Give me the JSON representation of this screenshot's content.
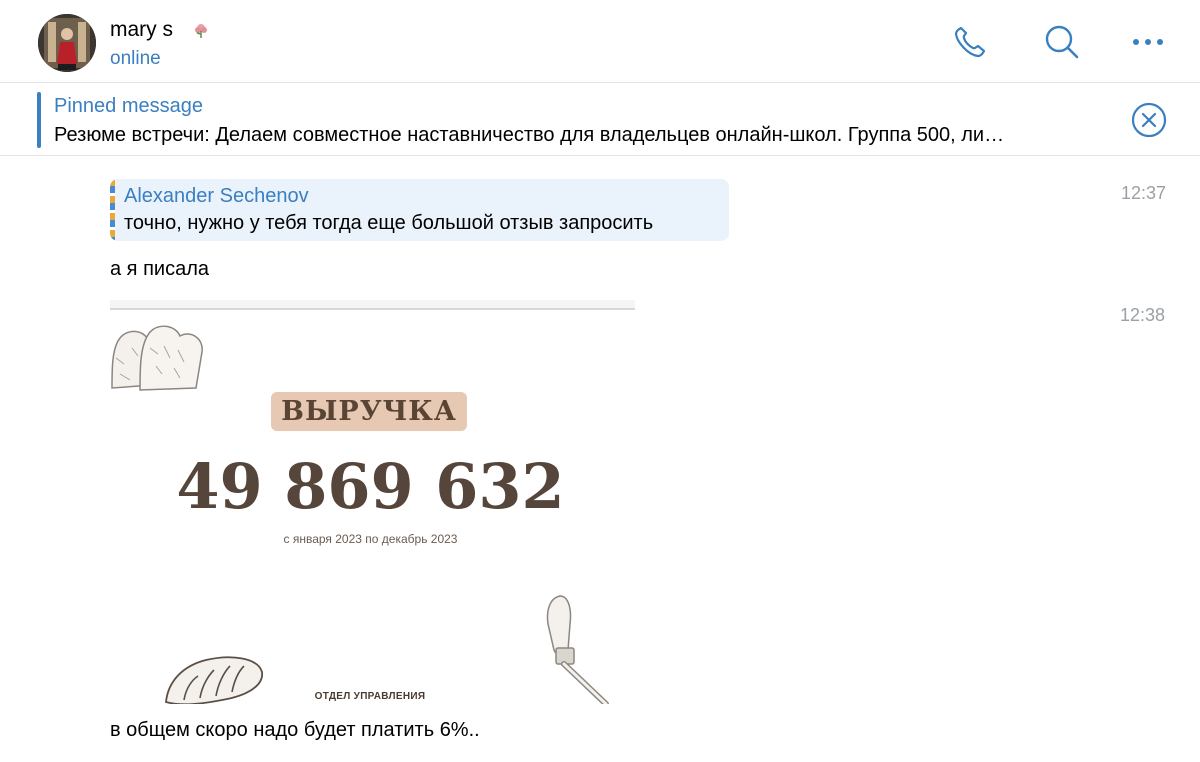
{
  "header": {
    "contact_name": "mary s",
    "status": "online",
    "icons": {
      "avatar": "profile-photo",
      "name_badge": "flower-emoji",
      "call": "phone-icon",
      "search": "search-icon",
      "more": "more-dots-icon"
    },
    "accent_color": "#3a7fc1"
  },
  "pinned": {
    "title": "Pinned message",
    "text": "Резюме встречи: Делаем совместное наставничество для владельцев онлайн-школ. Группа 500, ли…",
    "close_icon": "close-circle-icon"
  },
  "messages": [
    {
      "type": "reply",
      "author": "Alexander Sechenov",
      "text": "точно, нужно у тебя тогда еще большой отзыв запросить",
      "time": "12:37"
    },
    {
      "type": "text",
      "text": "а я писала"
    },
    {
      "type": "image",
      "time": "12:38",
      "image": {
        "badge": "ВЫРУЧКА",
        "amount": "49 869 632",
        "period": "с января 2023 по декабрь 2023",
        "department": "ОТДЕЛ УПРАВЛЕНИЯ",
        "badge_color": "#e6c8b3",
        "text_color": "#55453a"
      }
    },
    {
      "type": "text",
      "text": "в общем скоро надо будет платить 6%.."
    }
  ]
}
